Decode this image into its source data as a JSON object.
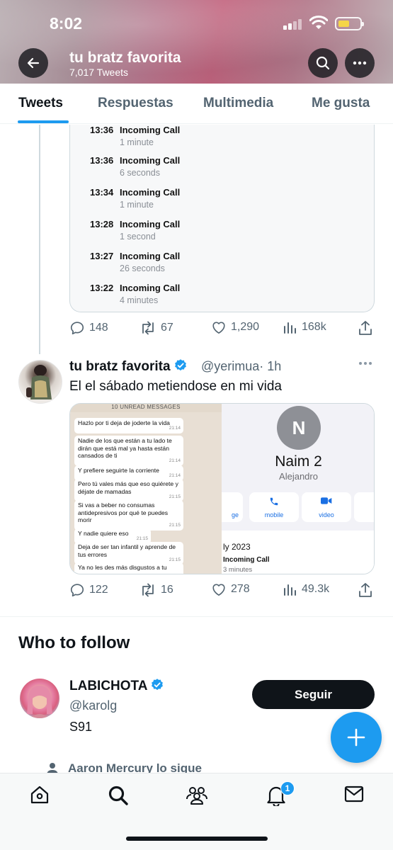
{
  "status_bar": {
    "time": "8:02"
  },
  "header": {
    "name": "tu bratz favorita",
    "tweet_count": "7,017 Tweets"
  },
  "tabs": [
    {
      "label": "Tweets"
    },
    {
      "label": "Respuestas"
    },
    {
      "label": "Multimedia"
    },
    {
      "label": "Me gusta"
    }
  ],
  "tweet1": {
    "calls": [
      {
        "time": "13:36",
        "label": "Incoming Call",
        "duration": "1 minute"
      },
      {
        "time": "13:36",
        "label": "Incoming Call",
        "duration": "6 seconds"
      },
      {
        "time": "13:34",
        "label": "Incoming Call",
        "duration": "1 minute"
      },
      {
        "time": "13:28",
        "label": "Incoming Call",
        "duration": "1 second"
      },
      {
        "time": "13:27",
        "label": "Incoming Call",
        "duration": "26 seconds"
      },
      {
        "time": "13:22",
        "label": "Incoming Call",
        "duration": "4 minutes"
      }
    ],
    "replies": "148",
    "retweets": "67",
    "likes": "1,290",
    "views": "168k"
  },
  "tweet2": {
    "name": "tu bratz favorita",
    "handle": "@yerimua",
    "time": "· 1h",
    "text": "El el sábado metiendose en mi vida",
    "chat": {
      "banner": "10 UNREAD MESSAGES",
      "messages": [
        {
          "text": "Hazlo por ti deja de joderte la vida",
          "time": "21:14"
        },
        {
          "text": "Nadie de los que están a tu lado te dirán que está mal ya hasta están cansados de ti",
          "time": "21:14"
        },
        {
          "text": "Y prefiere seguirte la corriente",
          "time": "21:14"
        },
        {
          "text": "Pero tú vales más que eso quiérete y déjate de mamadas",
          "time": "21:15"
        },
        {
          "text": "Si vas a beber no consumas antidepresivos por qué te puedes morir",
          "time": "21:15"
        },
        {
          "text": "Y nadie quiere eso",
          "time": "21:15"
        },
        {
          "text": "Deja de ser tan infantil y aprende de tus errores",
          "time": "21:15"
        },
        {
          "text": "Ya no les des más disgustos a tu",
          "time": ""
        }
      ]
    },
    "contact": {
      "initial": "N",
      "name": "Naim 2",
      "subtitle": "Alejandro",
      "buttons": [
        "ge",
        "mobile",
        "video"
      ],
      "date": "ly 2023",
      "incoming": "Incoming Call",
      "minutes": "3 minutes"
    },
    "replies": "122",
    "retweets": "16",
    "likes": "278",
    "views": "49.3k"
  },
  "who_to_follow": {
    "title": "Who to follow",
    "name": "LABICHOTA",
    "handle": "@karolg",
    "bio": "S91",
    "follow_label": "Seguir",
    "social_context": "Aaron Mercury lo sigue"
  },
  "bottom_nav": {
    "notification_count": "1"
  },
  "colors": {
    "accent": "#1d9bf0",
    "text": "#0f1419",
    "secondary": "#536471"
  },
  "icons": [
    "back-arrow-icon",
    "search-icon",
    "more-icon",
    "reply-icon",
    "retweet-icon",
    "like-icon",
    "views-icon",
    "share-icon",
    "verified-icon",
    "plus-icon",
    "home-icon",
    "communities-icon",
    "bell-icon",
    "mail-icon"
  ]
}
